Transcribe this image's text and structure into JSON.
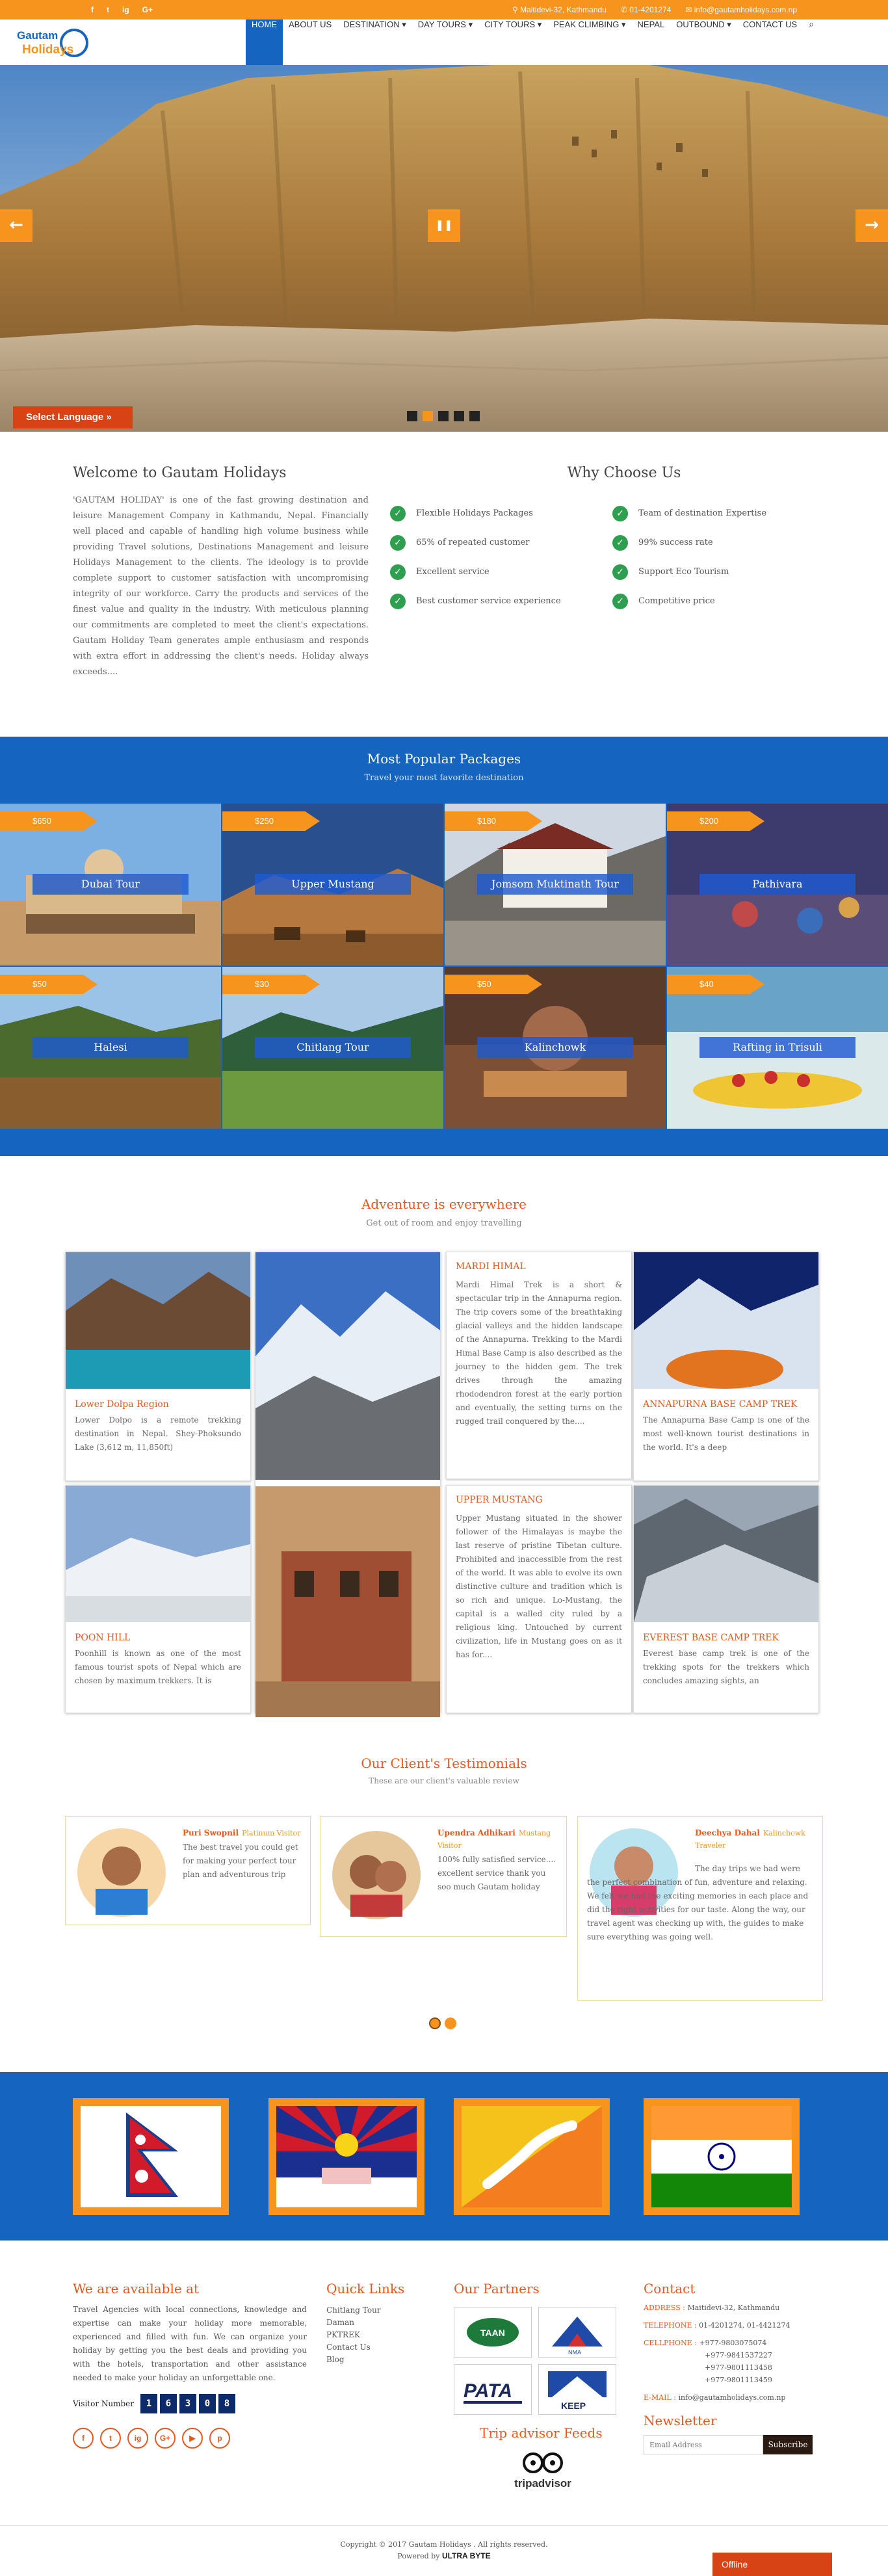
{
  "topbar": {
    "social": [
      "f",
      "t",
      "ig",
      "G+"
    ],
    "address": "Maitidevi-32, Kathmandu",
    "phone": "01-4201274",
    "email": "info@gautamholidays.com.np"
  },
  "brand": {
    "logo_line1": "Gautam",
    "logo_line2": "Holidays"
  },
  "nav": {
    "items": [
      "HOME",
      "ABOUT US",
      "DESTINATION ▾",
      "DAY TOURS ▾",
      "CITY TOURS ▾",
      "PEAK CLIMBING ▾",
      "NEPAL",
      "OUTBOUND ▾",
      "CONTACT US"
    ]
  },
  "hero": {
    "pause": "❚❚",
    "prev": "←",
    "next": "→",
    "language_button": "Select Language »",
    "slide_count": 5,
    "active_slide": 2
  },
  "welcome": {
    "title": "Welcome to Gautam Holidays",
    "text": "'GAUTAM HOLIDAY' is one of the fast growing destination and leisure Management Company in Kathmandu, Nepal. Financially well placed and capable of handling high volume business while providing Travel solutions, Destinations Management and leisure Holidays Management to the clients. The ideology is to provide complete support to customer satisfaction with uncompromising integrity of our workforce. Carry the products and services of the finest value and quality in the industry. With meticulous planning our commitments are completed to meet the client's expectations. Gautam Holiday Team generates ample enthusiasm and responds with extra effort in addressing the client's needs. Holiday always exceeds...."
  },
  "why": {
    "title": "Why Choose Us",
    "left": [
      "Flexible Holidays Packages",
      "65% of repeated customer",
      "Excellent service",
      "Best customer service experience"
    ],
    "right": [
      "Team of destination Expertise",
      "99% success rate",
      "Support Eco Tourism",
      "Competitive price"
    ]
  },
  "packages": {
    "title": "Most Popular Packages",
    "subtitle": "Travel your most favorite destination",
    "items": [
      {
        "price": "$650",
        "name": "Dubai Tour"
      },
      {
        "price": "$250",
        "name": "Upper Mustang"
      },
      {
        "price": "$180",
        "name": "Jomsom Muktinath Tour"
      },
      {
        "price": "$200",
        "name": "Pathivara"
      },
      {
        "price": "$50",
        "name": "Halesi"
      },
      {
        "price": "$30",
        "name": "Chitlang Tour"
      },
      {
        "price": "$50",
        "name": "Kalinchowk"
      },
      {
        "price": "$40",
        "name": "Rafting in Trisuli"
      }
    ]
  },
  "adventure": {
    "title": "Adventure is everywhere",
    "subtitle": "Get out of room and enjoy travelling",
    "cards": [
      {
        "title": "Lower Dolpa Region",
        "text": "Lower Dolpo is a remote trekking destination in Nepal. Shey-Phoksundo Lake (3,612 m, 11,850ft)"
      },
      {
        "title": "MARDI HIMAL",
        "text": "Mardi Himal Trek is a short & spectacular trip in the Annapurna region. The trip covers some of the breathtaking glacial valleys and the hidden landscape of the Annapurna. Trekking to the Mardi Himal Base Camp is also described as the journey to the hidden gem. The trek drives through the amazing rhododendron forest at the early portion and eventually, the setting turns on the rugged trail conquered by the...."
      },
      {
        "title": "ANNAPURNA BASE CAMP TREK",
        "text": "The Annapurna Base Camp is one of the most well-known tourist destinations in the world. It's a deep"
      },
      {
        "title": "POON HILL",
        "text": "Poonhill is known as one of the most famous tourist spots of Nepal which are chosen by maximum trekkers. It is"
      },
      {
        "title": "UPPER MUSTANG",
        "text": "Upper Mustang situated in the shower follower of the Himalayas is maybe the last reserve of pristine Tibetan culture. Prohibited and inaccessible from the rest of the world. It was able to evolve its own distinctive culture and tradition which is so rich and unique. Lo-Mustang, the capital is a walled city ruled by a religious king. Untouched by current civilization, life in Mustang goes on as it has for...."
      },
      {
        "title": "EVEREST BASE CAMP TREK",
        "text": "Everest base camp trek is one of the trekking spots for the trekkers which concludes amazing sights, an"
      }
    ]
  },
  "testimonials": {
    "title": "Our Client's Testimonials",
    "subtitle": "These are our client's valuable review",
    "items": [
      {
        "name": "Puri Swopnil",
        "role": "Platinum Visitor",
        "text": "The best travel you could get for making your perfect tour plan and adventurous trip"
      },
      {
        "name": "Upendra Adhikari",
        "role": "Mustang Visitor",
        "text": "100% fully satisfied service.... excellent service thank you soo much Gautam holiday"
      },
      {
        "name": "Deechya Dahal",
        "role": "Kalinchowk Traveler",
        "text": "The day trips we had were the perfect combination of fun, adventure and relaxing. We felt we had the exciting memories in each place and did the right activities for our taste. Along the way, our travel agent was checking up with, the guides to make sure everything was going well."
      }
    ]
  },
  "flags": [
    "Nepal",
    "Tibet",
    "Bhutan",
    "India"
  ],
  "footer": {
    "available_title": "We are available at",
    "available_text": "Travel Agencies with local connections, knowledge and expertise can make your holiday more memorable, experienced and filled with fun. We can organize your holiday by getting you the best deals and providing you with the hotels, transportation and other assistance needed to make your holiday an unforgettable one.",
    "visitor_label": "Visitor Number",
    "visitor_digits": [
      "1",
      "6",
      "3",
      "0",
      "8"
    ],
    "social": [
      "f",
      "t",
      "ig",
      "G+",
      "▶",
      "p"
    ],
    "quick_title": "Quick Links",
    "quick_links": [
      "Chitlang Tour",
      "Daman",
      "PKTREK",
      "Contact Us",
      "Blog"
    ],
    "partners_title": "Our Partners",
    "partners": [
      "TAAN",
      "NMA",
      "PATA",
      "KEEP"
    ],
    "tripadvisor_title": "Trip advisor Feeds",
    "tripadvisor_logo": "tripadvisor",
    "contact_title": "Contact",
    "address_label": "ADDRESS :",
    "address": "Maitidevi-32, Kathmandu",
    "telephone_label": "TELEPHONE :",
    "telephone": "01-4201274, 01-4421274",
    "cellphone_label": "CELLPHONE :",
    "cellphones": [
      "+977-9803075074",
      "+977-9841537227",
      "+977-9801113458",
      "+977-9801113459"
    ],
    "email_label": "E-MAIL :",
    "email": "info@gautamholidays.com.np",
    "newsletter_title": "Newsletter",
    "email_placeholder": "Email Address",
    "subscribe": "Subscribe",
    "copyright": "Copyright © 2017 Gautam Holidays . All rights reserved.",
    "powered_label": "Powered by",
    "powered_brand": "ULTRA BYTE",
    "offline": "Offline"
  },
  "colors": {
    "accent": "#f7941d",
    "blue": "#1565c0",
    "title_orange": "#e8581c",
    "green": "#2e9e4f"
  }
}
